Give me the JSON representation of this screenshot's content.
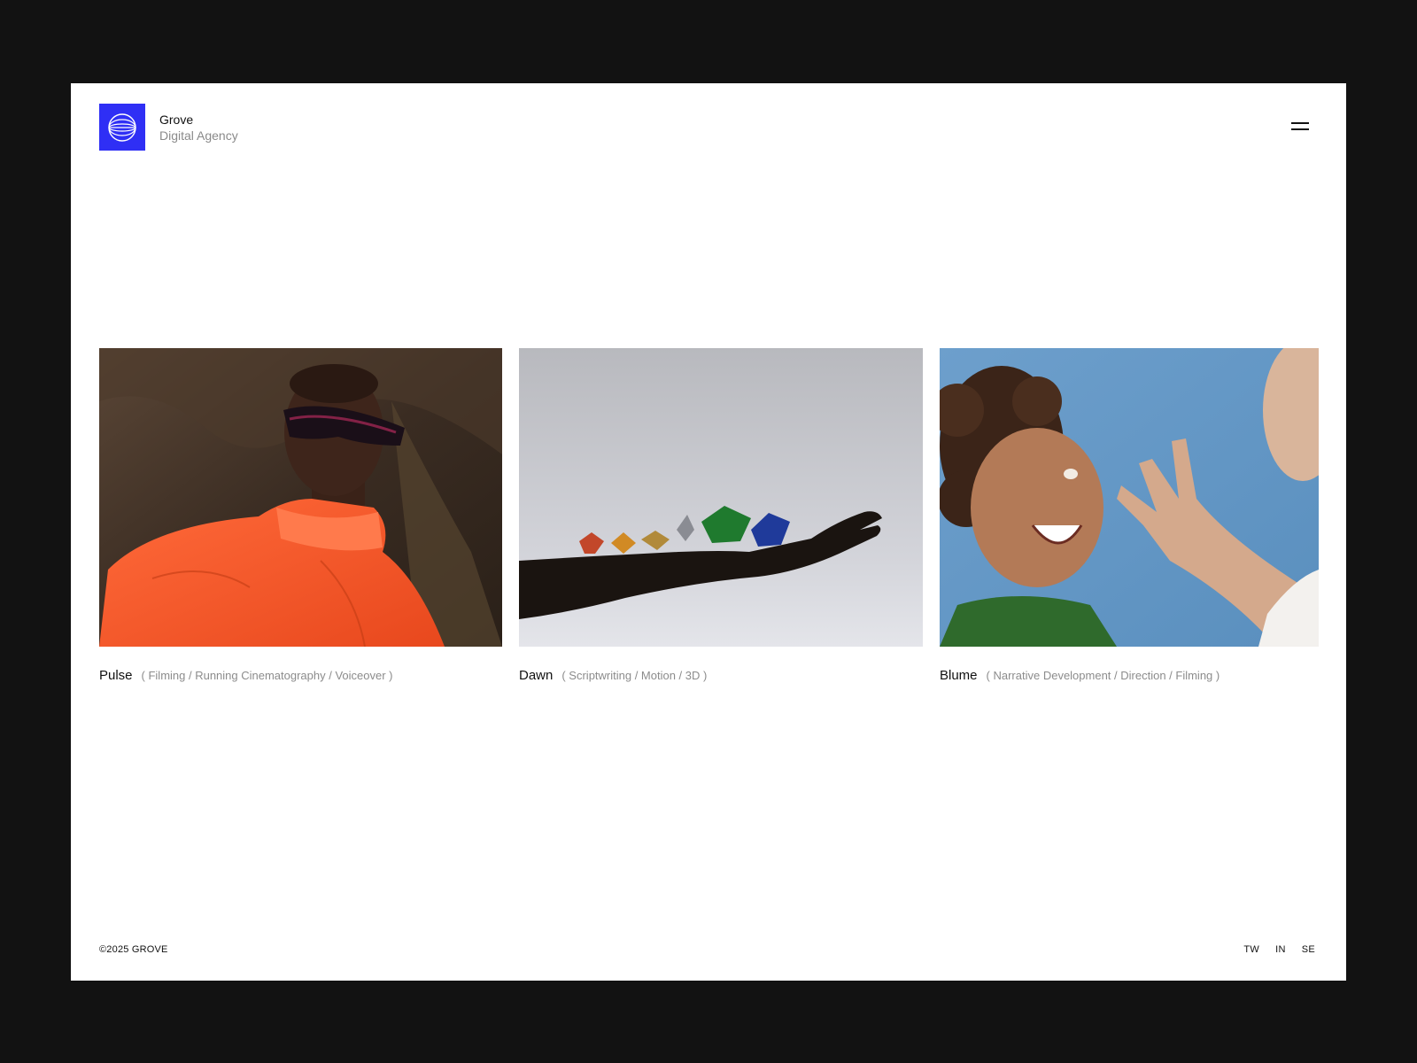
{
  "brand": {
    "name": "Grove",
    "tagline": "Digital Agency",
    "logo_color": "#2f2ff5",
    "logo_icon": "globe-icon"
  },
  "header": {
    "menu_icon": "hamburger-menu-icon"
  },
  "projects": [
    {
      "title": "Pulse",
      "tags": "( Filming / Running Cinematography / Voiceover )",
      "image": "portrait-orange-jacket-sunglasses"
    },
    {
      "title": "Dawn",
      "tags": "( Scriptwriting / Motion / 3D )",
      "image": "hand-holding-gemstones"
    },
    {
      "title": "Blume",
      "tags": "( Narrative Development / Direction / Filming )",
      "image": "laughing-woman-blue-background"
    }
  ],
  "footer": {
    "copyright": "©2025 GROVE",
    "social": [
      "TW",
      "IN",
      "SE"
    ]
  }
}
